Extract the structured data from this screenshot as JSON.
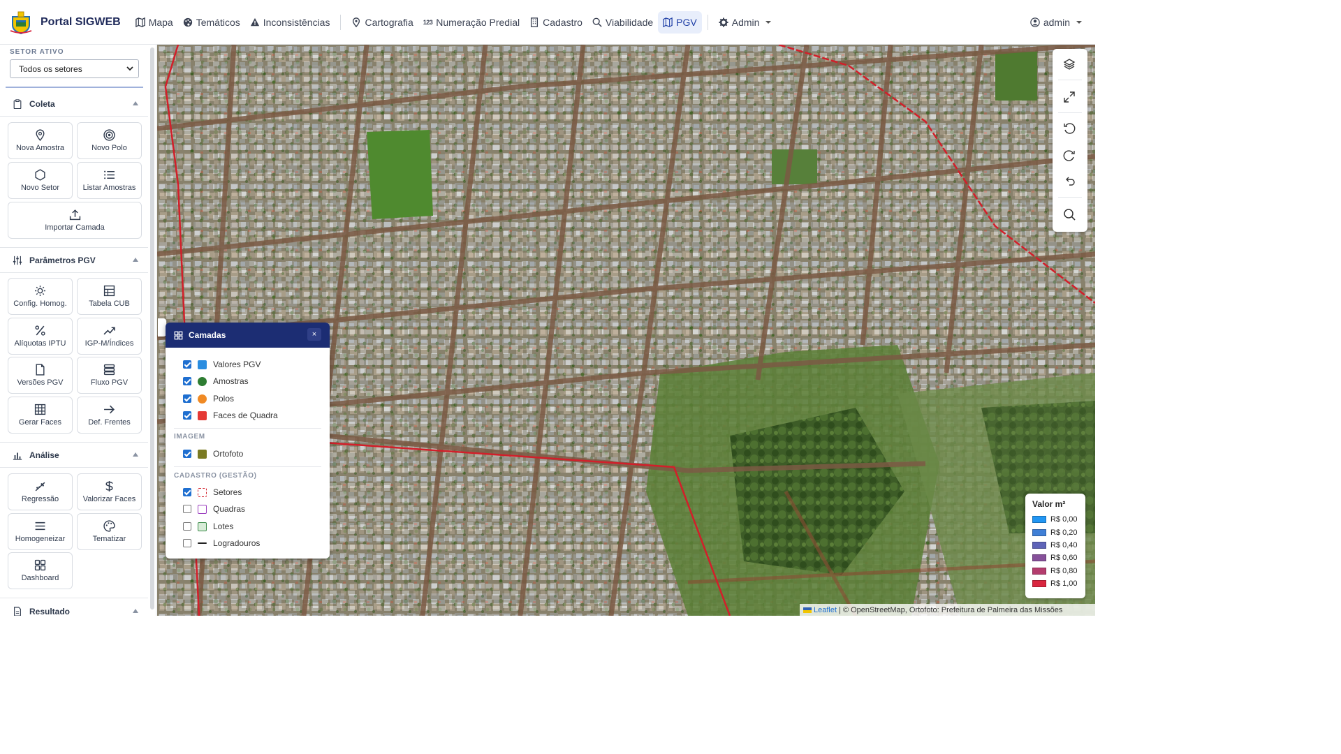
{
  "navbar": {
    "brand": "Portal SIGWEB",
    "items": [
      {
        "label": "Mapa",
        "icon": "map-icon"
      },
      {
        "label": "Temáticos",
        "icon": "palette-icon"
      },
      {
        "label": "Inconsistências",
        "icon": "warning-icon"
      },
      {
        "label": "Cartografia",
        "icon": "map-pin-icon"
      },
      {
        "label": "Numeração Predial",
        "icon": "numbers-icon",
        "prefix": "123"
      },
      {
        "label": "Cadastro",
        "icon": "building-icon"
      },
      {
        "label": "Viabilidade",
        "icon": "search-icon"
      },
      {
        "label": "PGV",
        "icon": "map-icon",
        "active": true
      },
      {
        "label": "Admin",
        "icon": "gear-icon"
      }
    ],
    "user": "admin"
  },
  "sidebar": {
    "setor_label": "SETOR ATIVO",
    "setor_value": "Todos os setores",
    "sections": {
      "coleta": {
        "title": "Coleta",
        "buttons": [
          "Nova Amostra",
          "Novo Polo",
          "Novo Setor",
          "Listar Amostras",
          "Importar Camada"
        ]
      },
      "parametros": {
        "title": "Parâmetros PGV",
        "buttons": [
          "Config. Homog.",
          "Tabela CUB",
          "Alíquotas IPTU",
          "IGP-M/Índices",
          "Versões PGV",
          "Fluxo PGV",
          "Gerar Faces",
          "Def. Frentes"
        ]
      },
      "analise": {
        "title": "Análise",
        "buttons": [
          "Regressão",
          "Valorizar Faces",
          "Homogeneizar",
          "Tematizar",
          "Dashboard"
        ]
      },
      "resultado": {
        "title": "Resultado"
      }
    }
  },
  "layers_panel": {
    "title": "Camadas",
    "close": "×",
    "pgv_layers": [
      {
        "label": "Valores PGV",
        "checked": true,
        "color": "#2a8de0"
      },
      {
        "label": "Amostras",
        "checked": true,
        "color": "#2e7d32"
      },
      {
        "label": "Polos",
        "checked": true,
        "color": "#f08a24"
      },
      {
        "label": "Faces de Quadra",
        "checked": true,
        "color": "#e53935"
      }
    ],
    "imagem_label": "IMAGEM",
    "imagem_layers": [
      {
        "label": "Ortofoto",
        "checked": true,
        "color": "#7a7a22"
      }
    ],
    "cadastro_label": "CADASTRO (GESTÃO)",
    "cadastro_layers": [
      {
        "label": "Setores",
        "checked": true,
        "style": "dashed-red"
      },
      {
        "label": "Quadras",
        "checked": false,
        "style": "outline-purple"
      },
      {
        "label": "Lotes",
        "checked": false,
        "style": "outline-green"
      },
      {
        "label": "Logradouros",
        "checked": false,
        "style": "line-black"
      }
    ]
  },
  "map_controls": [
    "layers-icon",
    "expand-icon",
    "rotate-left-icon",
    "rotate-right-icon",
    "undo-icon",
    "search-icon"
  ],
  "legend": {
    "title": "Valor m²",
    "items": [
      {
        "label": "R$ 0,00",
        "color": "#2196f3"
      },
      {
        "label": "R$ 0,20",
        "color": "#3f7fd6"
      },
      {
        "label": "R$ 0,40",
        "color": "#5f64b8"
      },
      {
        "label": "R$ 0,60",
        "color": "#86509a"
      },
      {
        "label": "R$ 0,80",
        "color": "#b43d6e"
      },
      {
        "label": "R$ 1,00",
        "color": "#d9263f"
      }
    ]
  },
  "attribution": {
    "leaflet": "Leaflet",
    "text": "| © OpenStreetMap, Ortofoto: Prefeitura de Palmeira das Missões"
  }
}
